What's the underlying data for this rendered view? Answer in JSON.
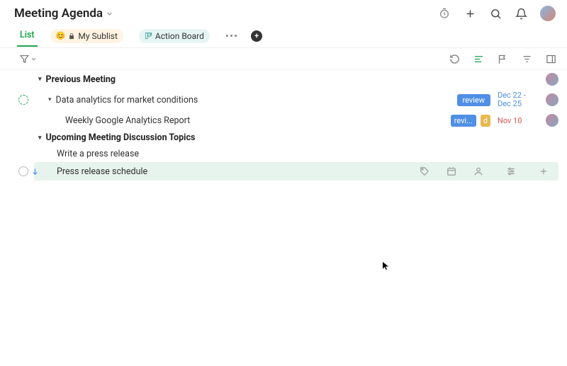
{
  "header": {
    "title": "Meeting Agenda"
  },
  "tabs": {
    "list": "List",
    "sublist": "My Sublist",
    "action": "Action Board"
  },
  "sections": [
    {
      "title": "Previous Meeting",
      "tasks": [
        {
          "title": "Data analytics for market conditions",
          "tag": "review",
          "date1": "Dec 22 -",
          "date2": "Dec 25",
          "dateClass": "blue",
          "hasToggle": true,
          "status": "progress"
        },
        {
          "title": "Weekly Google Analytics Report",
          "tagShort": "revi...",
          "tagExtra": "d",
          "date1": "Nov 10",
          "dateClass": "red",
          "sub": true
        }
      ]
    },
    {
      "title": "Upcoming Meeting Discussion Topics",
      "tasks": [
        {
          "title": "Write a press release"
        },
        {
          "title": "Press release schedule",
          "selected": true,
          "status": "empty",
          "inherit": true
        }
      ]
    }
  ]
}
